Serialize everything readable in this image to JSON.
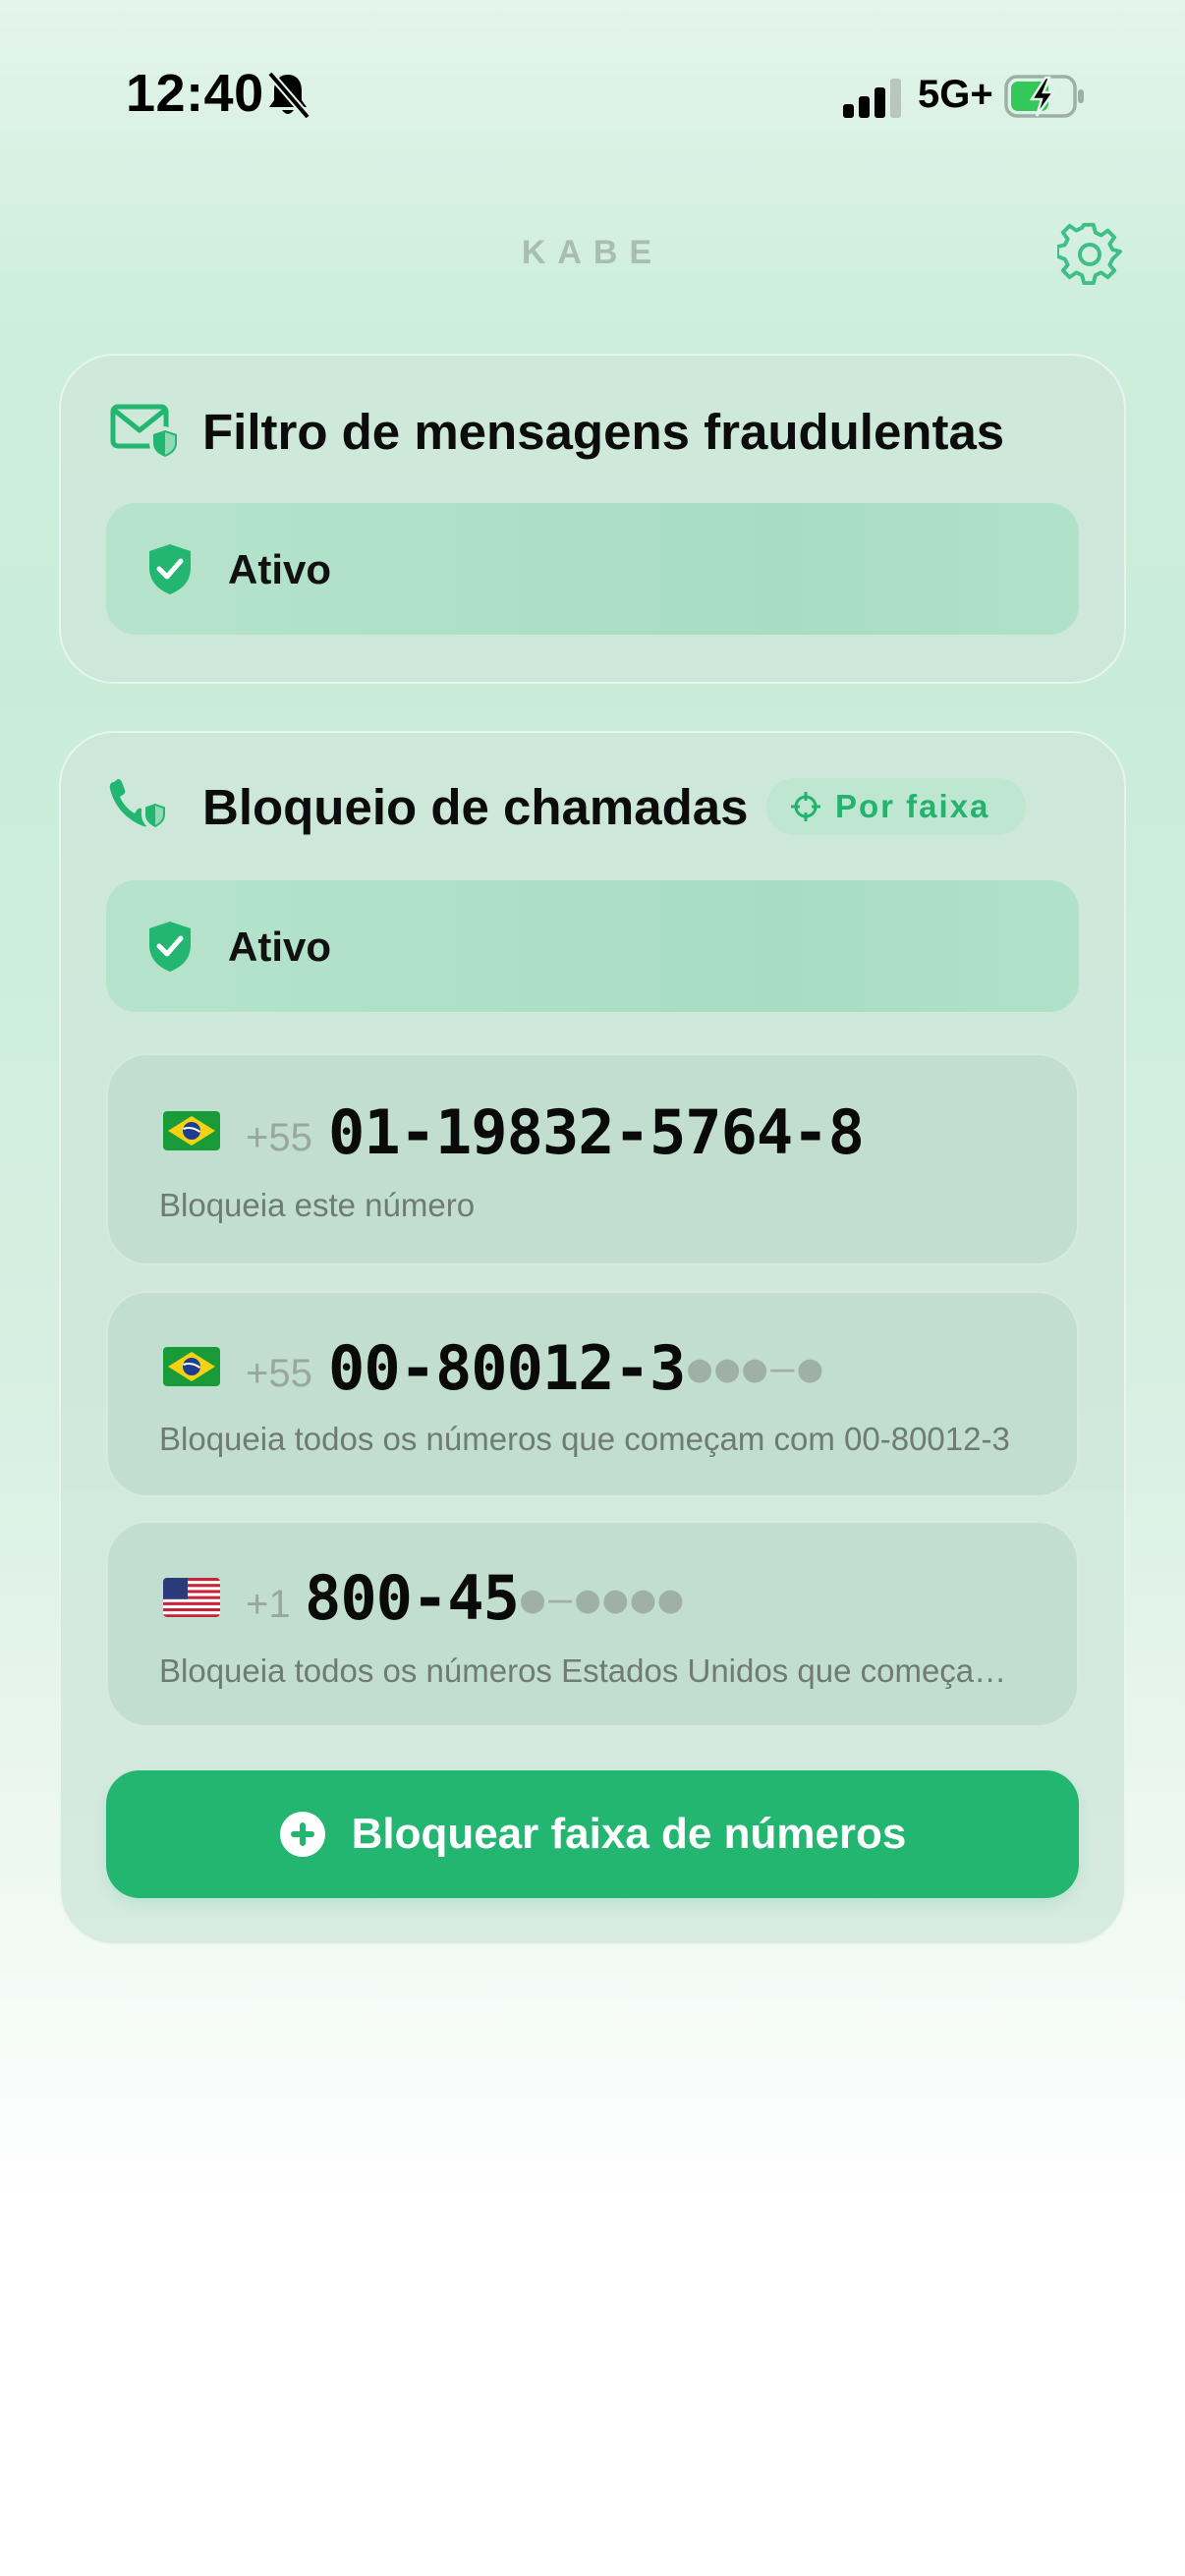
{
  "status_bar": {
    "time": "12:40",
    "network": "5G+",
    "icons": [
      "bell-slash-icon",
      "cellular-signal-icon",
      "battery-charging-icon"
    ]
  },
  "header": {
    "brand": "KABE",
    "settings_icon": "gear-icon"
  },
  "message_filter": {
    "title": "Filtro de mensagens fraudulentas",
    "icon": "envelope-shield-icon",
    "status": "Ativo"
  },
  "call_blocking": {
    "title": "Bloqueio de chamadas",
    "icon": "phone-shield-icon",
    "mode_chip": "Por faixa",
    "status": "Ativo",
    "rules": [
      {
        "flag": "brazil-flag",
        "country_code": "+55",
        "number": "01-19832-5764-8",
        "mask": "",
        "description": "Bloqueia este número"
      },
      {
        "flag": "brazil-flag",
        "country_code": "+55",
        "number": "00-80012-3",
        "mask": "●●●–●",
        "description": "Bloqueia todos os números que começam com 00-80012-3"
      },
      {
        "flag": "usa-flag",
        "country_code": "+1",
        "number": "800-45",
        "mask": "●–●●●●",
        "description": "Bloqueia todos os números Estados Unidos que começam..."
      }
    ],
    "add_button": "Bloquear faixa de números"
  },
  "colors": {
    "accent": "#23b670",
    "brand_text": "#a9bdb2"
  }
}
